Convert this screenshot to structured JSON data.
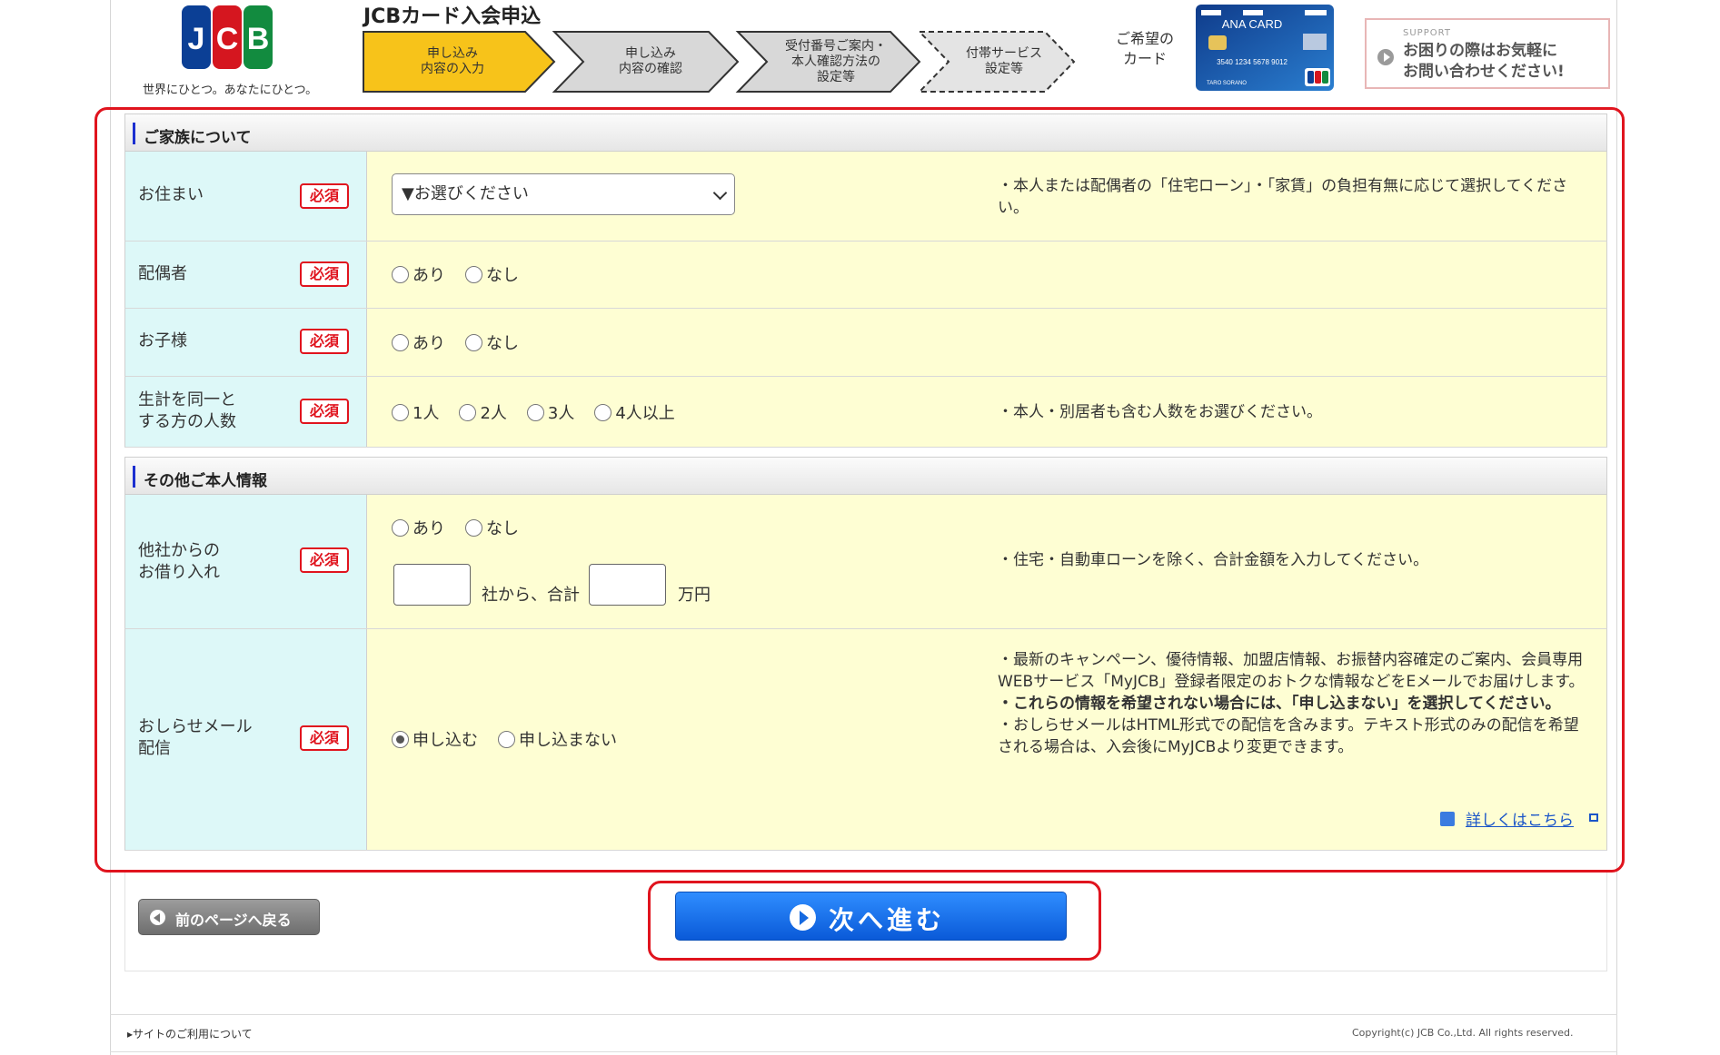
{
  "header": {
    "tagline": "世界にひとつ。あなたにひとつ。",
    "title": "JCBカード入会申込",
    "steps": [
      {
        "label": "申し込み\n内容の入力",
        "active": true
      },
      {
        "label": "申し込み\n内容の確認",
        "active": false
      },
      {
        "label": "受付番号ご案内・\n本人確認方法の\n設定等",
        "active": false
      },
      {
        "label": "付帯サービス\n設定等",
        "active": false
      }
    ],
    "desired_card_label": "ご希望の\nカード",
    "card": {
      "brand": "ANA CARD",
      "number": "3540 1234 5678 9012",
      "holder": "TARO SORANO"
    },
    "support_small": "SUPPORT",
    "support_text": "お困りの際はお気軽に\nお問い合わせください!"
  },
  "family_section": {
    "title": "ご家族について",
    "residence": {
      "label": "お住まい",
      "required": "必須",
      "select_value": "▼お選びください",
      "note": "・本人または配偶者の「住宅ローン」・「家賃」の負担有無に応じて選択してください。"
    },
    "spouse": {
      "label": "配偶者",
      "required": "必須",
      "options": [
        "あり",
        "なし"
      ]
    },
    "children": {
      "label": "お子様",
      "required": "必須",
      "options": [
        "あり",
        "なし"
      ]
    },
    "household": {
      "label": "生計を同一と\nする方の人数",
      "required": "必須",
      "options": [
        "1人",
        "2人",
        "3人",
        "4人以上"
      ],
      "note": "・本人・別居者も含む人数をお選びください。"
    }
  },
  "other_section": {
    "title": "その他ご本人情報",
    "borrowing": {
      "label": "他社からの\nお借り入れ",
      "required": "必須",
      "options": [
        "あり",
        "なし"
      ],
      "companies_suffix": "社から、合計",
      "amount_suffix": "万円",
      "note": "・住宅・自動車ローンを除く、合計金額を入力してください。"
    },
    "mail": {
      "label": "おしらせメール\n配信",
      "required": "必須",
      "options": [
        "申し込む",
        "申し込まない"
      ],
      "selected_index": 0,
      "note1": "・最新のキャンペーン、優待情報、加盟店情報、お振替内容確定のご案内、会員専用WEBサービス「MyJCB」登録者限定のおトクな情報などをEメールでお届けします。",
      "note2": "・これらの情報を希望されない場合には、「申し込まない」を選択してください。",
      "note3": "・おしらせメールはHTML形式での配信を含みます。テキスト形式のみの配信を希望される場合は、入会後にMyJCBより変更できます。",
      "link": "詳しくはこちら"
    }
  },
  "buttons": {
    "back": "前のページへ戻る",
    "next": "次へ進む"
  },
  "footer": {
    "left": "▸サイトのご利用について",
    "right": "Copyright(c) JCB Co.,Ltd. All rights reserved."
  },
  "colors": {
    "accent_red": "#e0141e",
    "primary_blue": "#0a5ad8",
    "step_active": "#f7c31a",
    "label_bg": "#ddf8f8",
    "field_bg": "#fefed3"
  }
}
